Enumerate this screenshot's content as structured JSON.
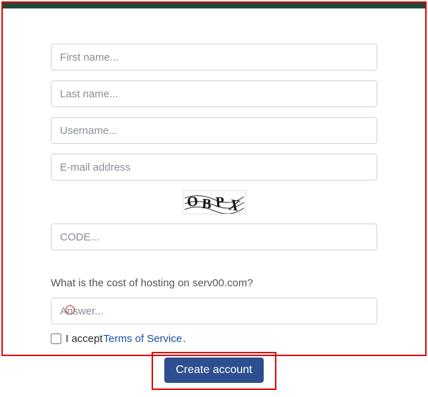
{
  "form": {
    "first_name_placeholder": "First name...",
    "last_name_placeholder": "Last name...",
    "username_placeholder": "Username...",
    "email_placeholder": "E-mail address",
    "code_placeholder": "CODE...",
    "answer_placeholder": "Answer..."
  },
  "captcha": {
    "text": "OBPX"
  },
  "question": "What is the cost of hosting on serv00.com?",
  "tos": {
    "prefix": "I accept ",
    "link_text": "Terms of Service",
    "suffix": "."
  },
  "buttons": {
    "submit": "Create account"
  }
}
